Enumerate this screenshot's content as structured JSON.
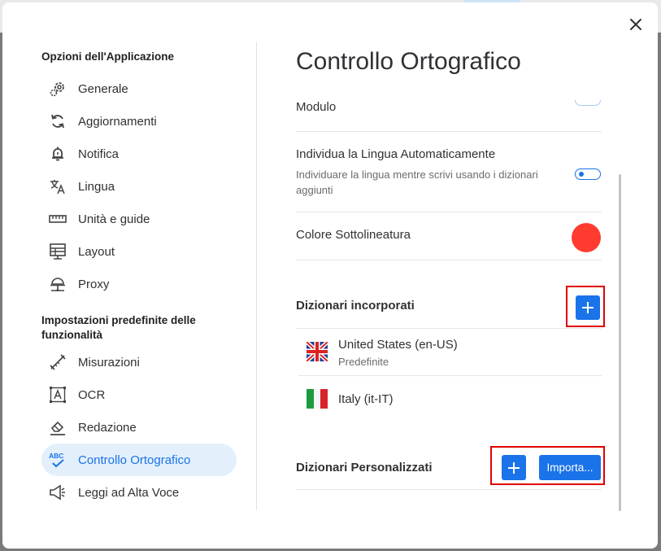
{
  "sidebar": {
    "section1": "Opzioni dell'Applicazione",
    "items1": [
      {
        "label": "Generale",
        "icon": "settings-gears-icon"
      },
      {
        "label": "Aggiornamenti",
        "icon": "sync-icon"
      },
      {
        "label": "Notifica",
        "icon": "bell-alert-icon"
      },
      {
        "label": "Lingua",
        "icon": "translate-icon"
      },
      {
        "label": "Unità e guide",
        "icon": "ruler-icon"
      },
      {
        "label": "Layout",
        "icon": "layout-icon"
      },
      {
        "label": "Proxy",
        "icon": "proxy-icon"
      }
    ],
    "section2": "Impostazioni predefinite delle funzionalità",
    "items2": [
      {
        "label": "Misurazioni",
        "icon": "measure-icon"
      },
      {
        "label": "OCR",
        "icon": "ocr-icon"
      },
      {
        "label": "Redazione",
        "icon": "eraser-icon"
      },
      {
        "label": "Controllo Ortografico",
        "icon": "spellcheck-icon",
        "active": true
      },
      {
        "label": "Leggi ad Alta Voce",
        "icon": "megaphone-icon"
      }
    ]
  },
  "content": {
    "title": "Controllo Ortografico",
    "module_label": "Modulo",
    "auto_detect": {
      "title": "Individua la Lingua Automaticamente",
      "desc": "Individuare la lingua mentre scrivi usando i dizionari aggiunti",
      "enabled": false
    },
    "underline_color": {
      "label": "Colore Sottolineatura",
      "color": "#ff3b30"
    },
    "builtin": {
      "title": "Dizionari incorporati",
      "dictionaries": [
        {
          "name": "United States (en-US)",
          "sub": "Predefinite",
          "flag": "uk-flag"
        },
        {
          "name": "Italy (it-IT)",
          "sub": "",
          "flag": "italy-flag"
        }
      ]
    },
    "custom": {
      "title": "Dizionari Personalizzati",
      "import_label": "Importa..."
    }
  },
  "colors": {
    "accent": "#1a73e8",
    "highlight": "#e00000",
    "active_bg": "#e3f0fc"
  }
}
